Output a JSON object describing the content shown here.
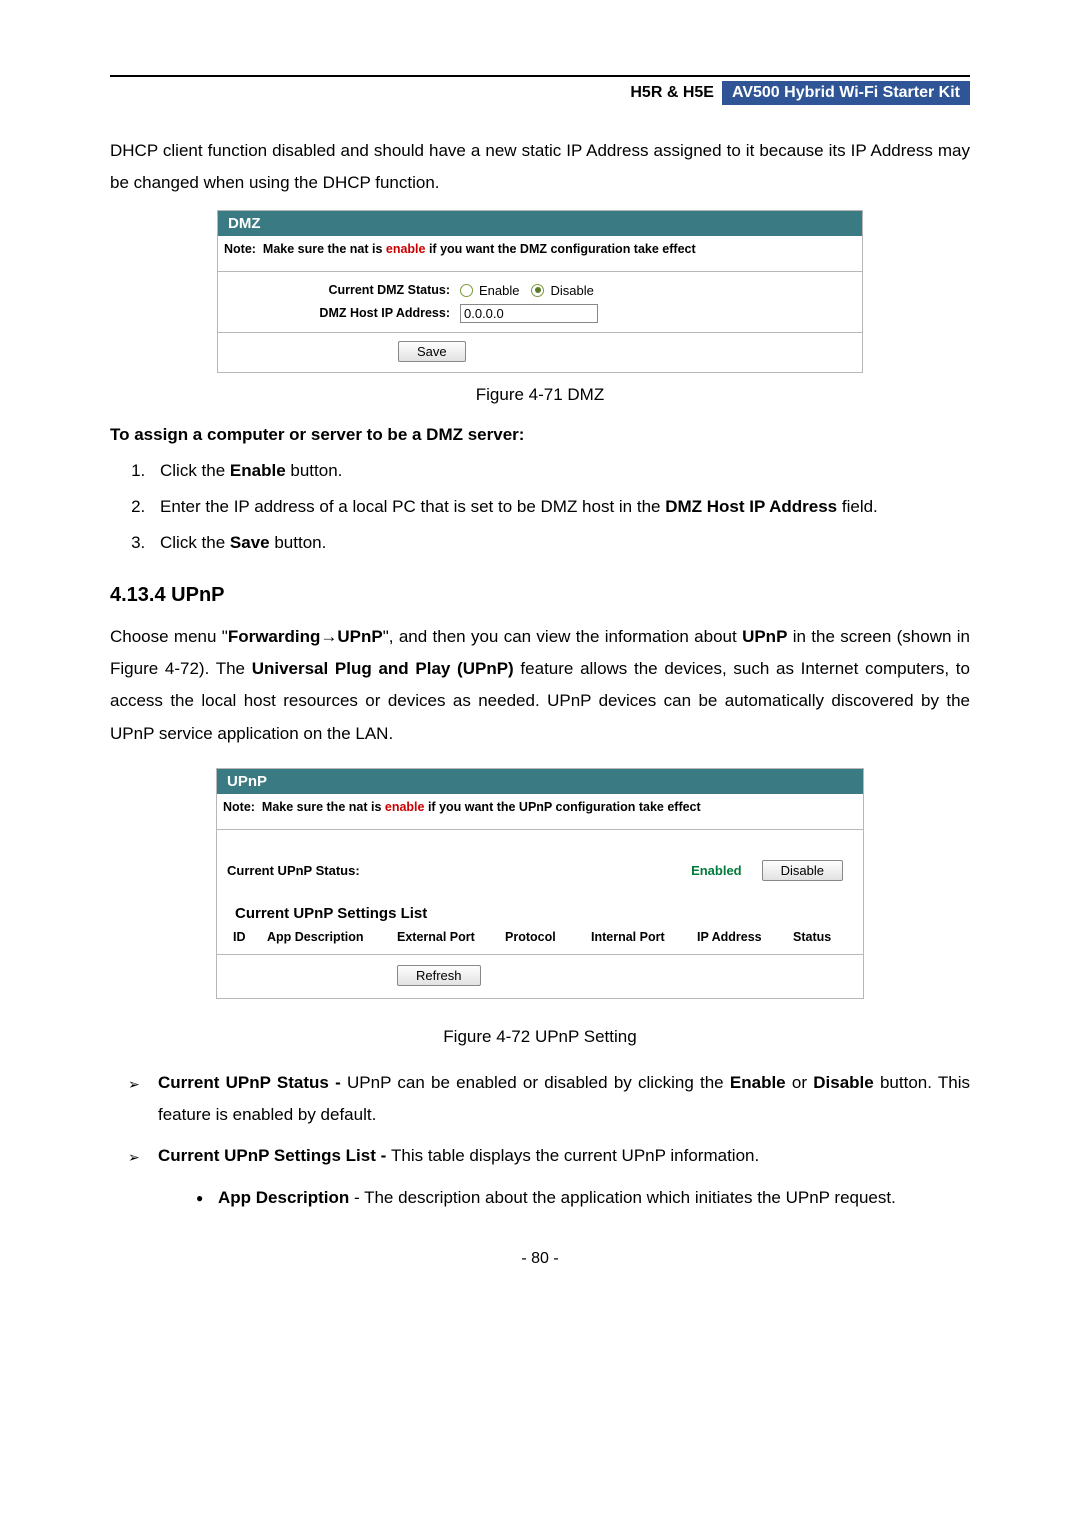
{
  "header": {
    "left": "H5R & H5E",
    "right": "AV500 Hybrid Wi-Fi Starter Kit"
  },
  "intro_para": "DHCP client function disabled and should have a new static IP Address assigned to it because its IP Address may be changed when using the DHCP function.",
  "dmz_panel": {
    "title": "DMZ",
    "note_prefix": "Note:",
    "note_mid1": "Make sure the nat is ",
    "note_enable": "enable",
    "note_mid2": " if you want the DMZ configuration take effect",
    "status_label": "Current DMZ Status:",
    "enable_label": "Enable",
    "disable_label": "Disable",
    "ip_label": "DMZ Host IP Address:",
    "ip_value": "0.0.0.0",
    "save_label": "Save"
  },
  "figure71": "Figure 4-71 DMZ",
  "assign_heading": "To assign a computer or server to be a DMZ server:",
  "steps": {
    "s1a": "Click the ",
    "s1b": "Enable",
    "s1c": " button.",
    "s2a": "Enter the IP address of a local PC that is set to be DMZ host in the ",
    "s2b": "DMZ Host IP Address",
    "s2c": " field.",
    "s3a": "Click the ",
    "s3b": "Save",
    "s3c": " button."
  },
  "upnp_heading": "4.13.4  UPnP",
  "upnp_para": {
    "p1": "Choose menu \"",
    "p2": "Forwarding",
    "arrow": "→",
    "p3": "UPnP",
    "p4": "\", and then you can view the information about ",
    "p5": "UPnP",
    "p6": " in the screen (shown in Figure 4-72). The ",
    "p7": "Universal Plug and Play (UPnP)",
    "p8": " feature allows the devices, such as Internet computers, to access the local host resources or devices as needed. UPnP devices can be automatically discovered by the UPnP service application on the LAN."
  },
  "upnp_panel": {
    "title": "UPnP",
    "note_prefix": "Note:",
    "note_mid1": "Make sure the nat is ",
    "note_enable": "enable",
    "note_mid2": " if you want the UPnP configuration take effect",
    "status_label": "Current UPnP Status:",
    "status_value": "Enabled",
    "disable_btn": "Disable",
    "list_title": "Current UPnP Settings List",
    "th_id": "ID",
    "th_app": "App Description",
    "th_ext": "External Port",
    "th_proto": "Protocol",
    "th_int": "Internal Port",
    "th_ip": "IP Address",
    "th_stat": "Status",
    "refresh_label": "Refresh"
  },
  "figure72": "Figure 4-72 UPnP Setting",
  "bullets": {
    "b1a": "Current UPnP Status - ",
    "b1b": "UPnP can be enabled or disabled by clicking the ",
    "b1c": "Enable",
    "b1d": " or ",
    "b1e": "Disable",
    "b1f": " button. This feature is enabled by default.",
    "b2a": "Current UPnP Settings List - ",
    "b2b": "This table displays the current UPnP information.",
    "sb1a": "App Description",
    "sb1b": " - The description about the application which initiates the UPnP request."
  },
  "page_number": "- 80 -"
}
